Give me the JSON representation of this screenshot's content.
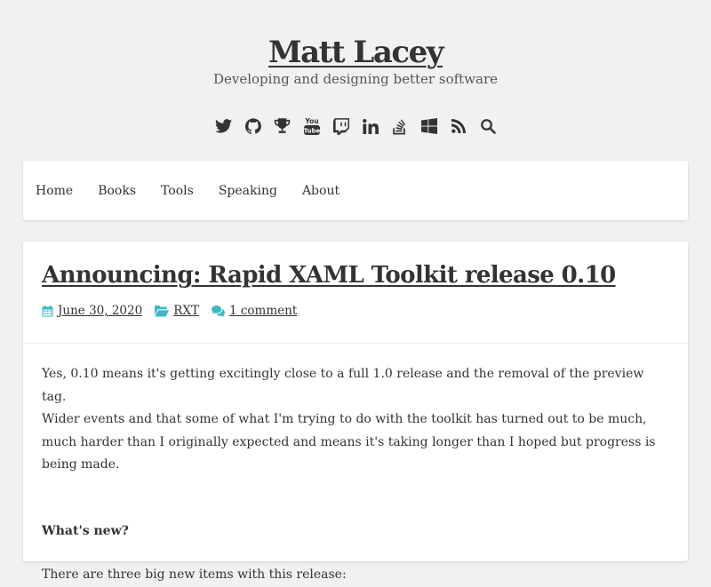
{
  "header": {
    "site_title": "Matt Lacey",
    "tagline": "Developing and designing better software"
  },
  "social_icons": [
    {
      "name": "twitter-icon"
    },
    {
      "name": "github-icon"
    },
    {
      "name": "trophy-icon"
    },
    {
      "name": "youtube-icon"
    },
    {
      "name": "twitch-icon"
    },
    {
      "name": "linkedin-icon"
    },
    {
      "name": "stackoverflow-icon"
    },
    {
      "name": "windows-icon"
    },
    {
      "name": "rss-icon"
    },
    {
      "name": "search-icon"
    }
  ],
  "nav": {
    "items": [
      "Home",
      "Books",
      "Tools",
      "Speaking",
      "About"
    ]
  },
  "post": {
    "title": "Announcing: Rapid XAML Toolkit release 0.10",
    "date": "June 30, 2020",
    "category": "RXT",
    "comments": "1 comment",
    "paragraph1_line1": "Yes, 0.10 means it's getting excitingly close to a full 1.0 release and the removal of the preview tag.",
    "paragraph1_line2": "Wider events and that some of what I'm trying to do with the toolkit has turned out to be much, much harder than I originally expected and means it's taking longer than I hoped but progress is being made.",
    "subheading": "What's new?",
    "paragraph2": "There are three big new items with this release:"
  },
  "colors": {
    "accent": "#3fb8c4",
    "background": "#f1f1f1",
    "text": "#333333"
  }
}
